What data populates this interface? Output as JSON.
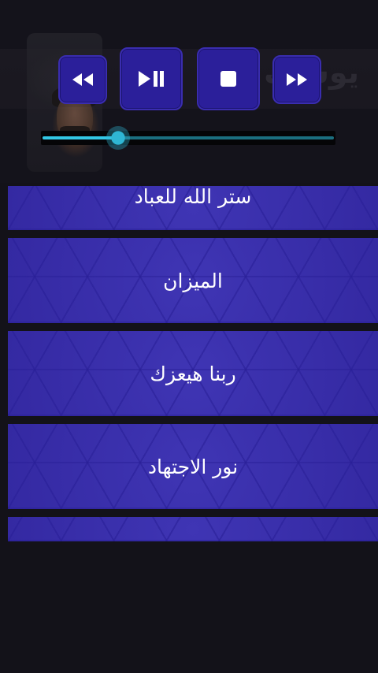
{
  "header": {
    "banner_title": "يوسف",
    "banner_subtitle": ""
  },
  "player": {
    "controls": [
      {
        "name": "rewind",
        "icon": "rewind-icon"
      },
      {
        "name": "play-pause",
        "icon": "play-pause-icon"
      },
      {
        "name": "stop",
        "icon": "stop-icon"
      },
      {
        "name": "fast-forward",
        "icon": "fast-forward-icon"
      }
    ],
    "seek_progress": 0.26,
    "colors": {
      "button_bg": "#2b1f9a",
      "seek_fill": "#33c8e6",
      "seek_rail": "#1b6f80"
    }
  },
  "tracks": [
    {
      "title": "ستر الله للعباد"
    },
    {
      "title": "الميزان"
    },
    {
      "title": "ربنا هيعزك"
    },
    {
      "title": "نور الاجتهاد"
    },
    {
      "title": ""
    }
  ],
  "colors": {
    "background": "#131219",
    "track_bg": "#3a2fa8",
    "track_text": "#ffffff"
  }
}
